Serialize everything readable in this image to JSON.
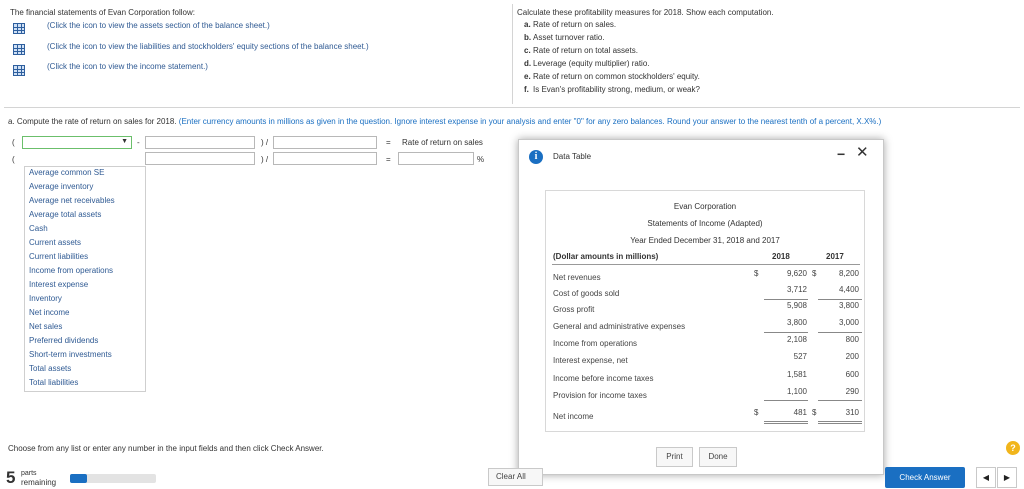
{
  "left_panel": {
    "intro": "The financial statements of Evan Corporation follow:",
    "links": [
      "(Click the icon to view the assets section of the balance sheet.)",
      "(Click the icon to view the liabilities and stockholders' equity sections of the balance sheet.)",
      "(Click the icon to view the income statement.)"
    ]
  },
  "right_panel": {
    "intro": "Calculate these profitability measures for 2018. Show each computation.",
    "items": [
      {
        "letter": "a.",
        "text": "Rate of return on sales."
      },
      {
        "letter": "b.",
        "text": "Asset turnover ratio."
      },
      {
        "letter": "c.",
        "text": "Rate of return on total assets."
      },
      {
        "letter": "d.",
        "text": "Leverage (equity multiplier) ratio."
      },
      {
        "letter": "e.",
        "text": "Rate of return on common stockholders' equity."
      },
      {
        "letter": "f.",
        "text": "Is Evan's profitability strong, medium, or weak?"
      }
    ]
  },
  "question": {
    "prefix": "a. Compute the rate of return on sales for 2018.",
    "instruction": "(Enter currency amounts in millions as given in the question. Ignore interest expense in your analysis and enter \"0\" for any zero balances. Round your answer to the nearest tenth of a percent, X.X%.)"
  },
  "formula": {
    "open_paren": "(",
    "minus": "-",
    "close_div": ") /",
    "equals": "=",
    "result_label": "Rate of return on sales",
    "percent": "%"
  },
  "dropdown_options": [
    "Average common SE",
    "Average inventory",
    "Average net receivables",
    "Average total assets",
    "Cash",
    "Current assets",
    "Current liabilities",
    "Income from operations",
    "Interest expense",
    "Inventory",
    "Net income",
    "Net sales",
    "Preferred dividends",
    "Short-term investments",
    "Total assets",
    "Total liabilities"
  ],
  "dialog": {
    "title": "Data Table",
    "company": "Evan Corporation",
    "statement": "Statements of Income (Adapted)",
    "period": "Year Ended December 31, 2018 and 2017",
    "header": {
      "label": "(Dollar amounts in millions)",
      "y1": "2018",
      "y2": "2017"
    },
    "rows": [
      {
        "label": "Net revenues",
        "cur1": "$",
        "v1": "9,620",
        "cur2": "$",
        "v2": "8,200"
      },
      {
        "label": "Cost of goods sold",
        "cur1": "",
        "v1": "3,712",
        "cur2": "",
        "v2": "4,400"
      },
      {
        "label": "Gross profit",
        "cur1": "",
        "v1": "5,908",
        "cur2": "",
        "v2": "3,800"
      },
      {
        "label": "General and administrative expenses",
        "cur1": "",
        "v1": "3,800",
        "cur2": "",
        "v2": "3,000"
      },
      {
        "label": "Income from operations",
        "cur1": "",
        "v1": "2,108",
        "cur2": "",
        "v2": "800"
      },
      {
        "label": "Interest expense, net",
        "cur1": "",
        "v1": "527",
        "cur2": "",
        "v2": "200"
      },
      {
        "label": "Income before income taxes",
        "cur1": "",
        "v1": "1,581",
        "cur2": "",
        "v2": "600"
      },
      {
        "label": "Provision for income taxes",
        "cur1": "",
        "v1": "1,100",
        "cur2": "",
        "v2": "290"
      },
      {
        "label": "Net income",
        "cur1": "$",
        "v1": "481",
        "cur2": "$",
        "v2": "310"
      }
    ],
    "print_label": "Print",
    "done_label": "Done",
    "minimize": "−",
    "close": "✕",
    "info": "i"
  },
  "footer": {
    "instruction": "Choose from any list or enter any number in the input fields and then click Check Answer.",
    "parts_count": "5",
    "parts_label": "parts",
    "remaining_label": "remaining",
    "progress": 0.2,
    "clear_all": "Clear All",
    "check_answer": "Check Answer",
    "help": "?",
    "prev": "◀",
    "next": "▶"
  },
  "colors": {
    "accent": "#1a6fc2",
    "link": "#2f5a93",
    "highlight_border": "#6bbf6b"
  }
}
